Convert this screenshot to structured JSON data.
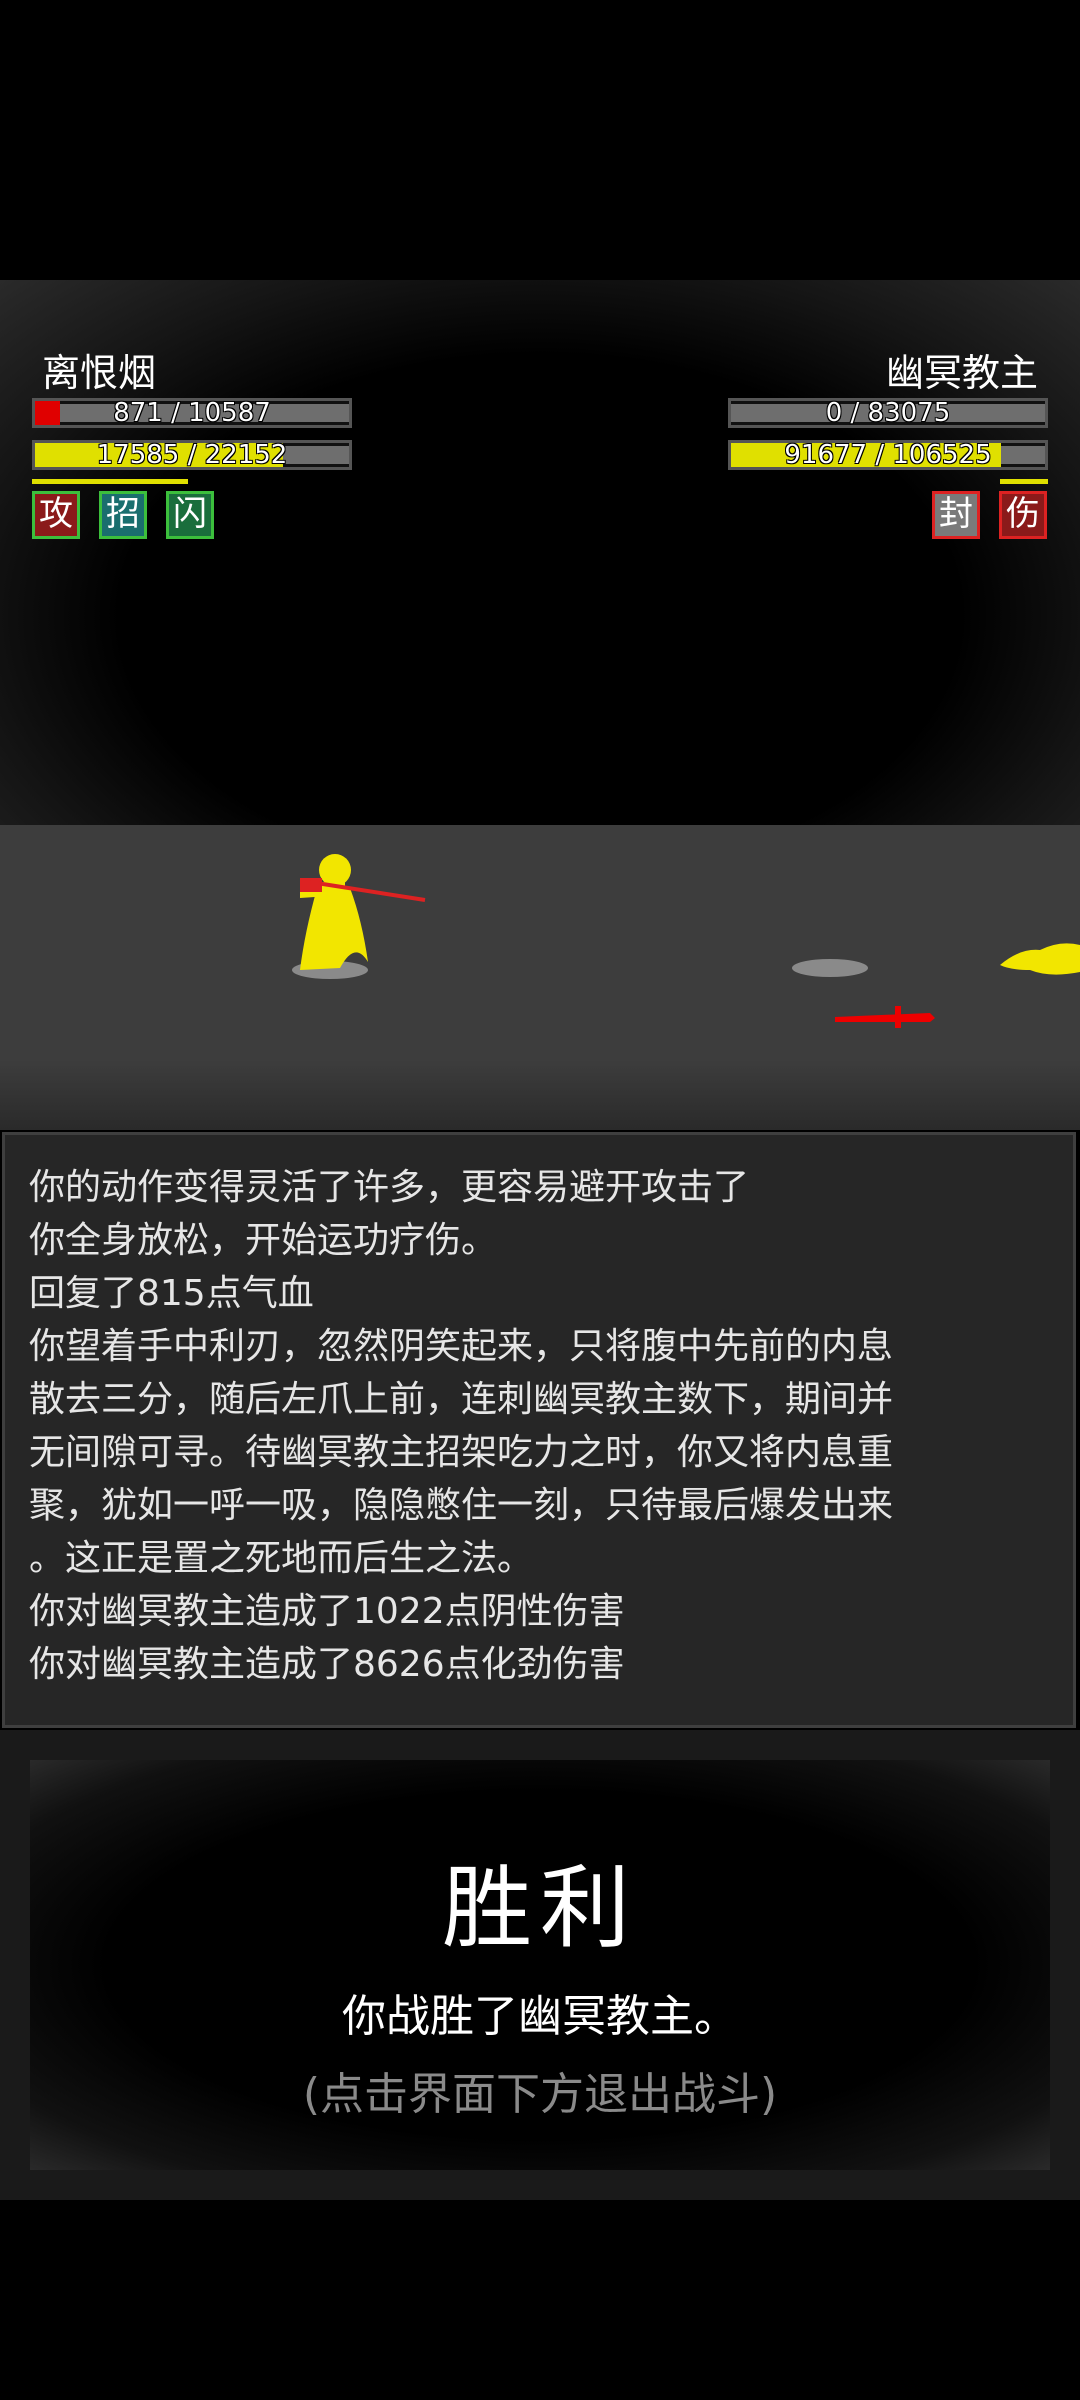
{
  "player": {
    "name": "离恨烟",
    "hp_text": "871 / 10587",
    "hp_fraction": 0.08,
    "mp_text": "17585 / 22152",
    "mp_fraction": 0.79,
    "tags": [
      {
        "label": "攻",
        "bg": "#8b1a1a",
        "border": "#3cbf3c"
      },
      {
        "label": "招",
        "bg": "#1a6e6e",
        "border": "#3cbf3c"
      },
      {
        "label": "闪",
        "bg": "#1a6e3c",
        "border": "#3cbf3c"
      }
    ]
  },
  "enemy": {
    "name": "幽冥教主",
    "hp_text": "0 / 83075",
    "hp_fraction": 0.0,
    "mp_text": "91677 / 106525",
    "mp_fraction": 0.86,
    "tags": [
      {
        "label": "封",
        "bg": "#7a7a7a",
        "border": "#d22"
      },
      {
        "label": "伤",
        "bg": "#8b1a1a",
        "border": "#d22"
      }
    ]
  },
  "colors": {
    "hp_red": "#e00000",
    "mp_yellow": "#e0e000",
    "bar_track": "#6e6e6e"
  },
  "log": {
    "lines": [
      "你的动作变得灵活了许多，更容易避开攻击了",
      "你全身放松，开始运功疗伤。",
      "回复了815点气血",
      "你望着手中利刃，忽然阴笑起来，只将腹中先前的内息",
      "散去三分，随后左爪上前，连刺幽冥教主数下，期间并",
      "无间隙可寻。待幽冥教主招架吃力之时，你又将内息重",
      "聚，犹如一呼一吸，隐隐憋住一刻，只待最后爆发出来",
      "。这正是置之死地而后生之法。",
      "你对幽冥教主造成了1022点阴性伤害",
      "你对幽冥教主造成了8626点化劲伤害"
    ]
  },
  "result": {
    "title": "胜利",
    "message": "你战胜了幽冥教主。",
    "hint": "(点击界面下方退出战斗)"
  }
}
